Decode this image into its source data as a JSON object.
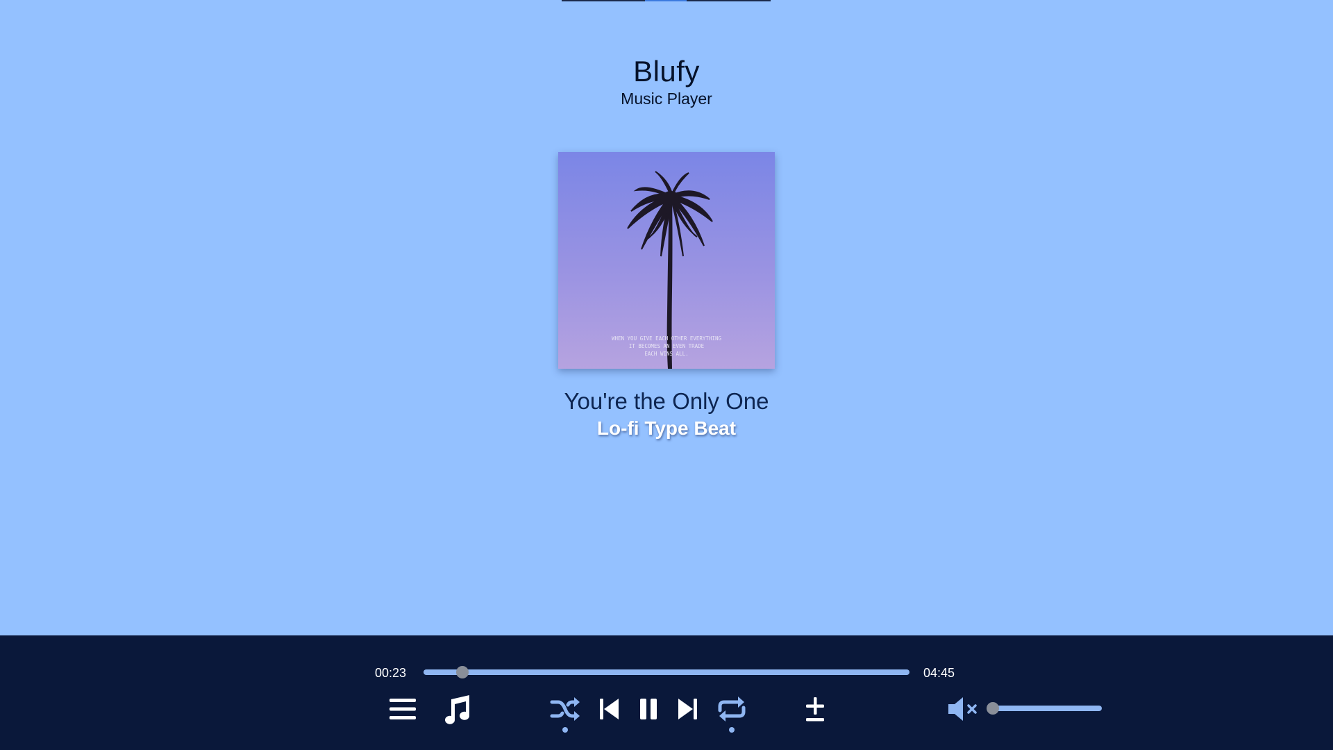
{
  "app": {
    "title": "Blufy",
    "subtitle": "Music Player"
  },
  "track": {
    "title": "You're the Only One",
    "artist": "Lo-fi Type Beat",
    "cover_caption": [
      "WHEN YOU GIVE EACH OTHER EVERYTHING",
      "IT BECOMES AN EVEN TRADE",
      "EACH WINS ALL."
    ]
  },
  "player": {
    "elapsed": "00:23",
    "duration": "04:45",
    "progress_fraction": 0.0807,
    "volume_fraction": 0.0,
    "muted": true,
    "shuffle_active": true,
    "repeat_active": true,
    "paused_icon_shown": "pause-icon"
  },
  "icons": {
    "menu": "menu-icon",
    "music": "music-note-icon",
    "shuffle": "shuffle-icon",
    "previous": "skip-previous-icon",
    "pause": "pause-icon",
    "next": "skip-next-icon",
    "repeat": "repeat-icon",
    "add": "add-to-playlist-icon",
    "volume": "volume-muted-icon"
  },
  "colors": {
    "background": "#94c1ff",
    "player_bar": "#0a183a",
    "accent": "#8fb6f2",
    "title_text": "#06122a",
    "song_title_text": "#0d2551"
  }
}
